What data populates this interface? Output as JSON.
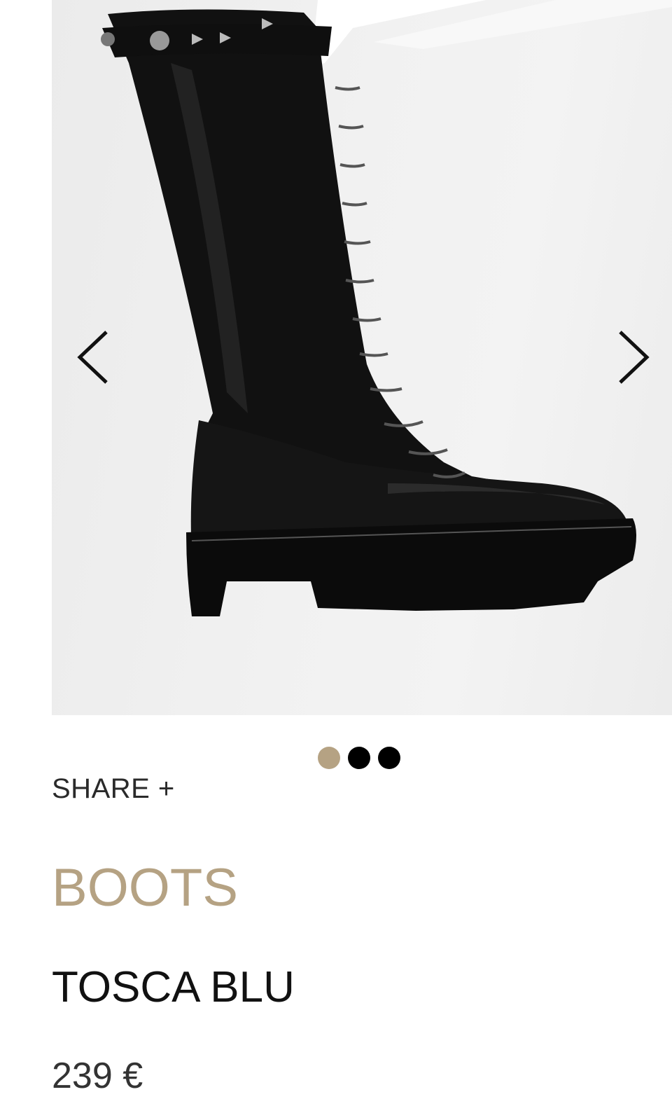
{
  "gallery": {
    "image_alt": "black lace-up boot",
    "prev_icon": "chevron-left-icon",
    "next_icon": "chevron-right-icon",
    "slide_count": 3,
    "active_index": 0
  },
  "share": {
    "label": "SHARE +"
  },
  "product": {
    "category": "BOOTS",
    "name": "TOSCA BLU",
    "price": "239 €"
  },
  "colors": {
    "accent": "#b5a283",
    "dot_inactive": "#000000"
  }
}
